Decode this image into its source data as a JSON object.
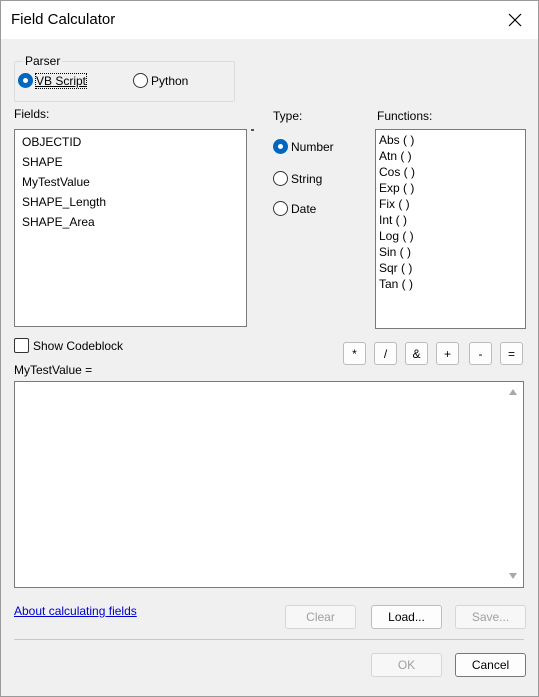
{
  "window": {
    "title": "Field Calculator"
  },
  "parser": {
    "label": "Parser",
    "options": [
      {
        "label": "VB Script",
        "checked": true
      },
      {
        "label": "Python",
        "checked": false
      }
    ]
  },
  "fields": {
    "label": "Fields:",
    "items": [
      "OBJECTID",
      "SHAPE",
      "MyTestValue",
      "SHAPE_Length",
      "SHAPE_Area"
    ]
  },
  "type": {
    "label": "Type:",
    "options": [
      {
        "label": "Number",
        "checked": true
      },
      {
        "label": "String",
        "checked": false
      },
      {
        "label": "Date",
        "checked": false
      }
    ]
  },
  "functions": {
    "label": "Functions:",
    "items": [
      "Abs (  )",
      "Atn (  )",
      "Cos (  )",
      "Exp (  )",
      "Fix (  )",
      "Int (  )",
      "Log (  )",
      "Sin (  )",
      "Sqr (  )",
      "Tan (  )"
    ]
  },
  "codeblock": {
    "label": "Show Codeblock",
    "checked": false
  },
  "operators": [
    "*",
    "/",
    "&",
    "+",
    "-",
    "="
  ],
  "expression": {
    "label": "MyTestValue =",
    "value": ""
  },
  "links": {
    "about": "About calculating fields"
  },
  "buttons": {
    "clear": "Clear",
    "load": "Load...",
    "save": "Save...",
    "ok": "OK",
    "cancel": "Cancel"
  }
}
